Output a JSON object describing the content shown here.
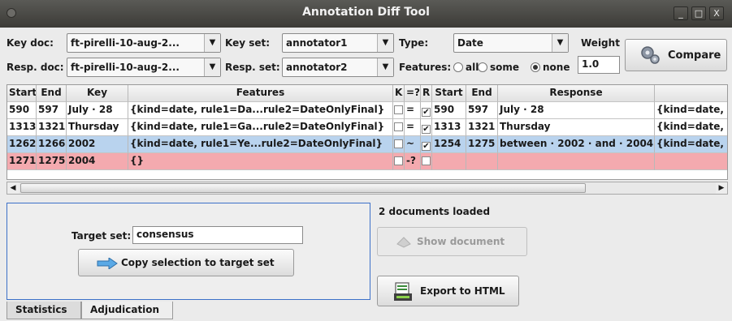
{
  "window": {
    "title": "Annotation Diff Tool",
    "controls": [
      "_",
      "□",
      "X"
    ]
  },
  "form": {
    "key_doc_label": "Key doc:",
    "key_doc_value": "ft-pirelli-10-aug-2...",
    "key_set_label": "Key set:",
    "key_set_value": "annotator1",
    "type_label": "Type:",
    "type_value": "Date",
    "weight_label": "Weight",
    "resp_doc_label": "Resp. doc:",
    "resp_doc_value": "ft-pirelli-10-aug-2...",
    "resp_set_label": "Resp. set:",
    "resp_set_value": "annotator2",
    "features_label": "Features:",
    "features_options": [
      "all",
      "some",
      "none"
    ],
    "features_selected": "none",
    "weight_value": "1.0",
    "compare_label": "Compare"
  },
  "table": {
    "headers": [
      "Start",
      "End",
      "Key",
      "Features",
      "K",
      "=?",
      "R",
      "Start",
      "End",
      "Response",
      ""
    ],
    "rows": [
      {
        "kstart": "590",
        "kend": "597",
        "key": "July · 28",
        "kfeat": "{kind=date, rule1=Da...rule2=DateOnlyFinal}",
        "kchk": "",
        "match": "=",
        "rchk": "✔",
        "rstart": "590",
        "rend": "597",
        "response": "July · 28",
        "rfeat": "{kind=date, ru",
        "state": "normal"
      },
      {
        "kstart": "1313",
        "kend": "1321",
        "key": "Thursday",
        "kfeat": "{kind=date, rule1=Ga...rule2=DateOnlyFinal}",
        "kchk": "",
        "match": "=",
        "rchk": "✔",
        "rstart": "1313",
        "rend": "1321",
        "response": "Thursday",
        "rfeat": "{kind=date, ru",
        "state": "normal"
      },
      {
        "kstart": "1262",
        "kend": "1266",
        "key": "2002",
        "kfeat": "{kind=date, rule1=Ye...rule2=DateOnlyFinal}",
        "kchk": "",
        "match": "~",
        "rchk": "✔",
        "rstart": "1254",
        "rend": "1275",
        "response": "between · 2002 · and · 2004",
        "rfeat": "{kind=date, ru",
        "state": "selected"
      },
      {
        "kstart": "1271",
        "kend": "1275",
        "key": "2004",
        "kfeat": "{}",
        "kchk": "",
        "match": "-?",
        "rchk": "",
        "rstart": "",
        "rend": "",
        "response": "",
        "rfeat": "",
        "state": "error"
      }
    ]
  },
  "adjudication": {
    "target_set_label": "Target set:",
    "target_set_value": "consensus",
    "copy_button_label": "Copy selection to target set"
  },
  "status": {
    "documents_loaded": "2 documents loaded"
  },
  "buttons": {
    "show_document": "Show document",
    "export_html": "Export to HTML"
  },
  "tabs": [
    "Statistics",
    "Adjudication"
  ],
  "colors": {
    "selected_row": "#b9d3ee",
    "error_row": "#f4aaaf",
    "panel_border": "#3c70c8"
  }
}
